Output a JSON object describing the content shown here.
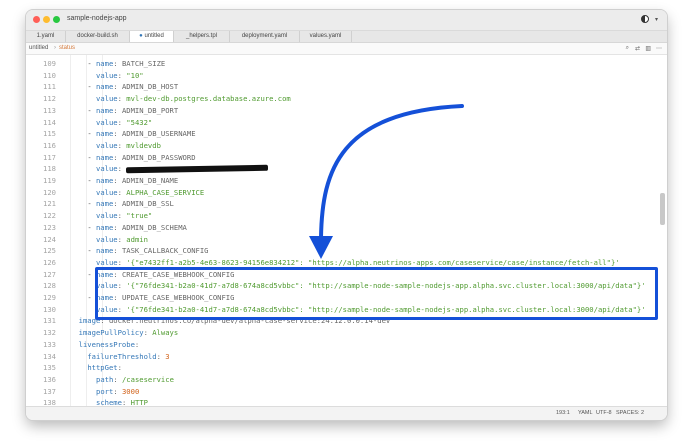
{
  "window": {
    "title": "sample-nodejs-app"
  },
  "tabs": [
    {
      "label": "1.yaml",
      "active": false
    },
    {
      "label": "docker-build.sh",
      "active": false
    },
    {
      "label": "untitled",
      "active": true
    },
    {
      "label": "_helpers.tpl",
      "active": false
    },
    {
      "label": "deployment.yaml",
      "active": false
    },
    {
      "label": "values.yaml",
      "active": false
    }
  ],
  "breadcrumb": {
    "file": "untitled",
    "separator": "›",
    "symbol": "status"
  },
  "toolbar": {
    "icons": [
      "search-icon",
      "replace-icon",
      "split-icon",
      "more-icon"
    ]
  },
  "colors": {
    "key": "#3477b7",
    "string": "#4f9a2f",
    "number": "#d1621a",
    "highlight_box": "#1450d8"
  },
  "editor": {
    "lines": [
      {
        "no": "109",
        "indent": 4,
        "dash": true,
        "key": "name",
        "value": "BATCH_SIZE",
        "vtype": "plain"
      },
      {
        "no": "110",
        "indent": 6,
        "dash": false,
        "key": "value",
        "value": "\"10\"",
        "vtype": "string"
      },
      {
        "no": "111",
        "indent": 4,
        "dash": true,
        "key": "name",
        "value": "ADMIN_DB_HOST",
        "vtype": "plain"
      },
      {
        "no": "112",
        "indent": 6,
        "dash": false,
        "key": "value",
        "value": "mvl-dev-db.postgres.database.azure.com",
        "vtype": "string"
      },
      {
        "no": "113",
        "indent": 4,
        "dash": true,
        "key": "name",
        "value": "ADMIN_DB_PORT",
        "vtype": "plain"
      },
      {
        "no": "114",
        "indent": 6,
        "dash": false,
        "key": "value",
        "value": "\"5432\"",
        "vtype": "string"
      },
      {
        "no": "115",
        "indent": 4,
        "dash": true,
        "key": "name",
        "value": "ADMIN_DB_USERNAME",
        "vtype": "plain"
      },
      {
        "no": "116",
        "indent": 6,
        "dash": false,
        "key": "value",
        "value": "mvldevdb",
        "vtype": "string"
      },
      {
        "no": "117",
        "indent": 4,
        "dash": true,
        "key": "name",
        "value": "ADMIN_DB_PASSWORD",
        "vtype": "plain"
      },
      {
        "no": "118",
        "indent": 6,
        "dash": false,
        "key": "value",
        "value": "",
        "vtype": "redacted"
      },
      {
        "no": "119",
        "indent": 4,
        "dash": true,
        "key": "name",
        "value": "ADMIN_DB_NAME",
        "vtype": "plain"
      },
      {
        "no": "120",
        "indent": 6,
        "dash": false,
        "key": "value",
        "value": "ALPHA_CASE_SERVICE",
        "vtype": "string"
      },
      {
        "no": "121",
        "indent": 4,
        "dash": true,
        "key": "name",
        "value": "ADMIN_DB_SSL",
        "vtype": "plain"
      },
      {
        "no": "122",
        "indent": 6,
        "dash": false,
        "key": "value",
        "value": "\"true\"",
        "vtype": "string"
      },
      {
        "no": "123",
        "indent": 4,
        "dash": true,
        "key": "name",
        "value": "ADMIN_DB_SCHEMA",
        "vtype": "plain"
      },
      {
        "no": "124",
        "indent": 6,
        "dash": false,
        "key": "value",
        "value": "admin",
        "vtype": "string"
      },
      {
        "no": "125",
        "indent": 4,
        "dash": true,
        "key": "name",
        "value": "TASK_CALLBACK_CONFIG",
        "vtype": "plain"
      },
      {
        "no": "126",
        "indent": 6,
        "dash": false,
        "key": "value",
        "value": "'{\"e7432ff1-a2b5-4e63-8623-94156e834212\": \"https://alpha.neutrinos-apps.com/caseservice/case/instance/fetch-all\"}'",
        "vtype": "string"
      },
      {
        "no": "127",
        "indent": 4,
        "dash": true,
        "key": "name",
        "value": "CREATE_CASE_WEBHOOK_CONFIG",
        "vtype": "plain"
      },
      {
        "no": "128",
        "indent": 6,
        "dash": false,
        "key": "value",
        "value": "'{\"76fde341-b2a0-41d7-a7d8-674a8cd5vbbc\": \"http://sample-node-sample-nodejs-app.alpha.svc.cluster.local:3000/api/data\"}'",
        "vtype": "string"
      },
      {
        "no": "129",
        "indent": 4,
        "dash": true,
        "key": "name",
        "value": "UPDATE_CASE_WEBHOOK_CONFIG",
        "vtype": "plain"
      },
      {
        "no": "130",
        "indent": 6,
        "dash": false,
        "key": "value",
        "value": "'{\"76fde341-b2a0-41d7-a7d8-674a8cd5vbbc\": \"http://sample-node-sample-nodejs-app.alpha.svc.cluster.local:3000/api/data\"}'",
        "vtype": "string"
      },
      {
        "no": "131",
        "indent": 2,
        "dash": false,
        "key": "image",
        "value": "docker.neutrinos.co/alpha-dev/alpha-case-service:24.12.0.0.14-dev",
        "vtype": "plain"
      },
      {
        "no": "132",
        "indent": 2,
        "dash": false,
        "key": "imagePullPolicy",
        "value": "Always",
        "vtype": "string"
      },
      {
        "no": "133",
        "indent": 2,
        "dash": false,
        "key": "livenessProbe",
        "value": "",
        "vtype": "none"
      },
      {
        "no": "134",
        "indent": 4,
        "dash": false,
        "key": "failureThreshold",
        "value": "3",
        "vtype": "number"
      },
      {
        "no": "135",
        "indent": 4,
        "dash": false,
        "key": "httpGet",
        "value": "",
        "vtype": "none"
      },
      {
        "no": "136",
        "indent": 6,
        "dash": false,
        "key": "path",
        "value": "/caseservice",
        "vtype": "string"
      },
      {
        "no": "137",
        "indent": 6,
        "dash": false,
        "key": "port",
        "value": "3000",
        "vtype": "number"
      },
      {
        "no": "138",
        "indent": 6,
        "dash": false,
        "key": "scheme",
        "value": "HTTP",
        "vtype": "string"
      }
    ]
  },
  "statusbar": {
    "position": "193:1",
    "language": "YAML",
    "encoding": "UTF-8",
    "spaces": "SPACES: 2"
  }
}
